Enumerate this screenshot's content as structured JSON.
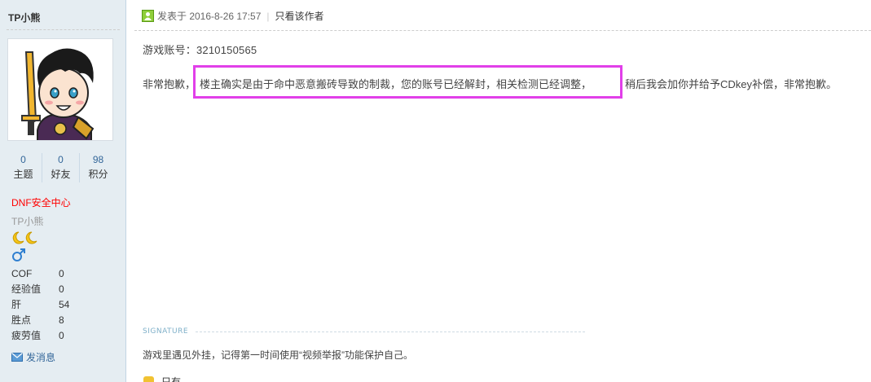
{
  "sidebar": {
    "username": "TP小熊",
    "stats": [
      {
        "num": "0",
        "label": "主题"
      },
      {
        "num": "0",
        "label": "好友"
      },
      {
        "num": "98",
        "label": "积分"
      }
    ],
    "group": "DNF安全中心",
    "title": "TP小熊",
    "profile": [
      {
        "label": "COF",
        "value": "0"
      },
      {
        "label": "经验值",
        "value": "0"
      },
      {
        "label": "肝",
        "value": "54"
      },
      {
        "label": "胜点",
        "value": "8"
      },
      {
        "label": "疲劳值",
        "value": "0"
      }
    ],
    "send_message": "发消息"
  },
  "post": {
    "posted_at": "发表于 2016-8-26 17:57",
    "only_author": "只看该作者",
    "account_line": "游戏账号：3210150565",
    "body_prefix": "非常抱歉，",
    "body_highlight": "楼主确实是由于命中恶意搬砖导致的制裁，您的账号已经解封，相关检测已经调整，",
    "body_suffix": "稍后我会加你并给予CDkey补偿，非常抱歉。",
    "signature_label": "SIGNATURE",
    "signature_text": "游戏里遇见外挂，记得第一时间使用“视频举报”功能保护自己。",
    "next_partial": "只有"
  },
  "colors": {
    "sidebar_bg": "#e5edf2",
    "highlight_border": "#e13fe9",
    "group_red": "#ff0000",
    "link_blue": "#336699"
  }
}
